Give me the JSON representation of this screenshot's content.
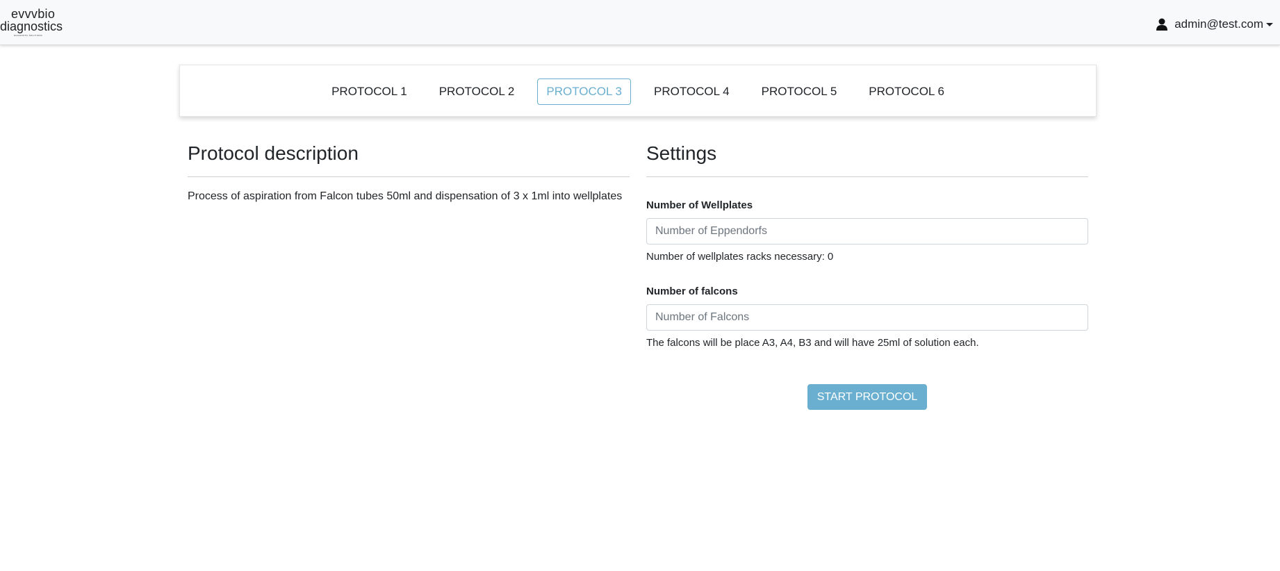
{
  "brand": {
    "line1": "evvvbio",
    "line2": "diagnostics",
    "tagline": "DIAGNOSTIC SOLUTIONS"
  },
  "user": {
    "icon": "user-icon",
    "email": "admin@test.com"
  },
  "tabs": [
    {
      "label": "PROTOCOL 1",
      "active": false
    },
    {
      "label": "PROTOCOL 2",
      "active": false
    },
    {
      "label": "PROTOCOL 3",
      "active": true
    },
    {
      "label": "PROTOCOL 4",
      "active": false
    },
    {
      "label": "PROTOCOL 5",
      "active": false
    },
    {
      "label": "PROTOCOL 6",
      "active": false
    }
  ],
  "description": {
    "title": "Protocol description",
    "text": "Process of aspiration from Falcon tubes 50ml and dispensation of 3 x 1ml into wellplates"
  },
  "settings": {
    "title": "Settings",
    "wellplates": {
      "label": "Number of Wellplates",
      "value": "",
      "placeholder": "Number of Eppendorfs",
      "help": "Number of wellplates racks necessary: 0"
    },
    "falcons": {
      "label": "Number of falcons",
      "value": "",
      "placeholder": "Number of Falcons",
      "help": "The falcons will be place A3, A4, B3 and will have 25ml of solution each."
    },
    "start_label": "START PROTOCOL"
  },
  "colors": {
    "accent": "#6aafd0",
    "navbar_bg": "#f8f9fa",
    "text": "#212529"
  }
}
